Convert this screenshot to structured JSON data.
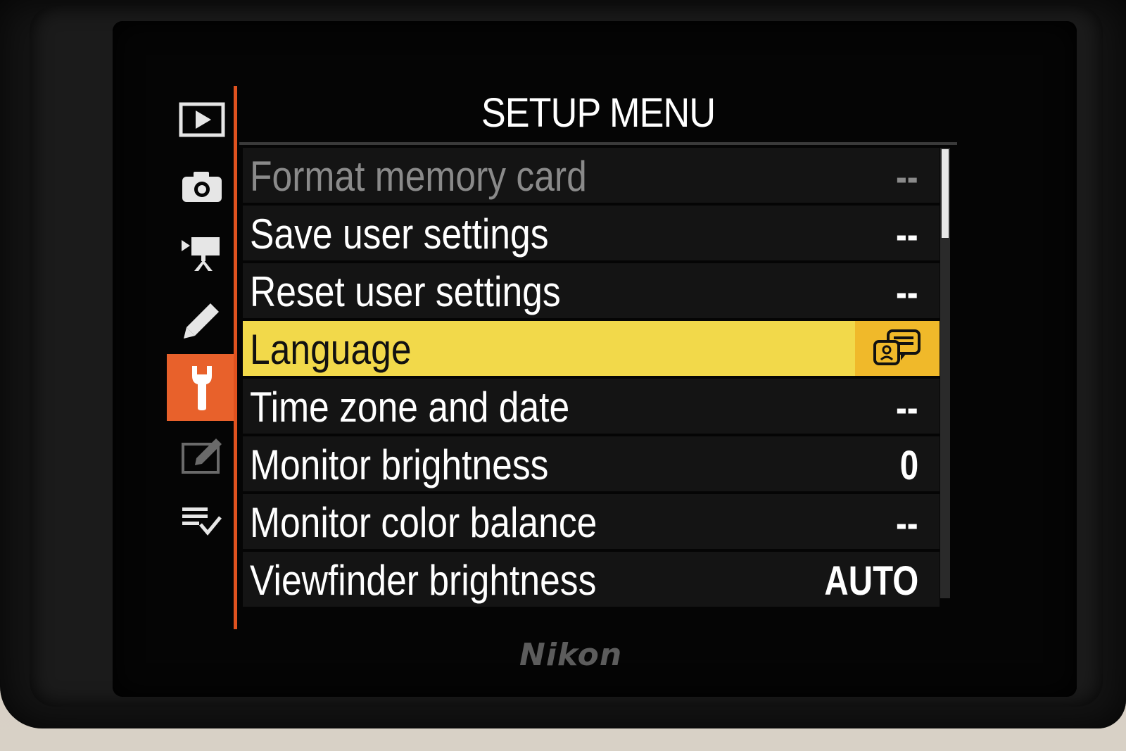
{
  "screen": {
    "title": "SETUP MENU",
    "brand": "Nikon"
  },
  "tabs": [
    {
      "icon": "playback-icon",
      "active": false
    },
    {
      "icon": "camera-icon",
      "active": false
    },
    {
      "icon": "movie-icon",
      "active": false
    },
    {
      "icon": "pencil-icon",
      "active": false
    },
    {
      "icon": "wrench-icon",
      "active": true
    },
    {
      "icon": "retouch-icon",
      "active": false
    },
    {
      "icon": "my-menu-icon",
      "active": false
    }
  ],
  "menu": {
    "items": [
      {
        "label": "Format memory card",
        "value": "--",
        "state": "dimmed"
      },
      {
        "label": "Save user settings",
        "value": "--",
        "state": "normal"
      },
      {
        "label": "Reset user settings",
        "value": "--",
        "state": "normal"
      },
      {
        "label": "Language",
        "value_icon": "language-icon",
        "state": "selected"
      },
      {
        "label": "Time zone and date",
        "value": "--",
        "state": "normal"
      },
      {
        "label": "Monitor brightness",
        "value": "0",
        "state": "normal"
      },
      {
        "label": "Monitor color balance",
        "value": "--",
        "state": "normal"
      },
      {
        "label": "Viewfinder brightness",
        "value": "AUTO",
        "state": "normal"
      }
    ]
  },
  "colors": {
    "accent_tab": "#e8612b",
    "selected_row": "#f2d94a",
    "selected_value_cell": "#f0b92a",
    "row_bg": "#141414",
    "text": "#ffffff",
    "dimmed_text": "#8a8a8a"
  },
  "scroll": {
    "position_fraction": 0.0,
    "visible_fraction": 0.2
  }
}
